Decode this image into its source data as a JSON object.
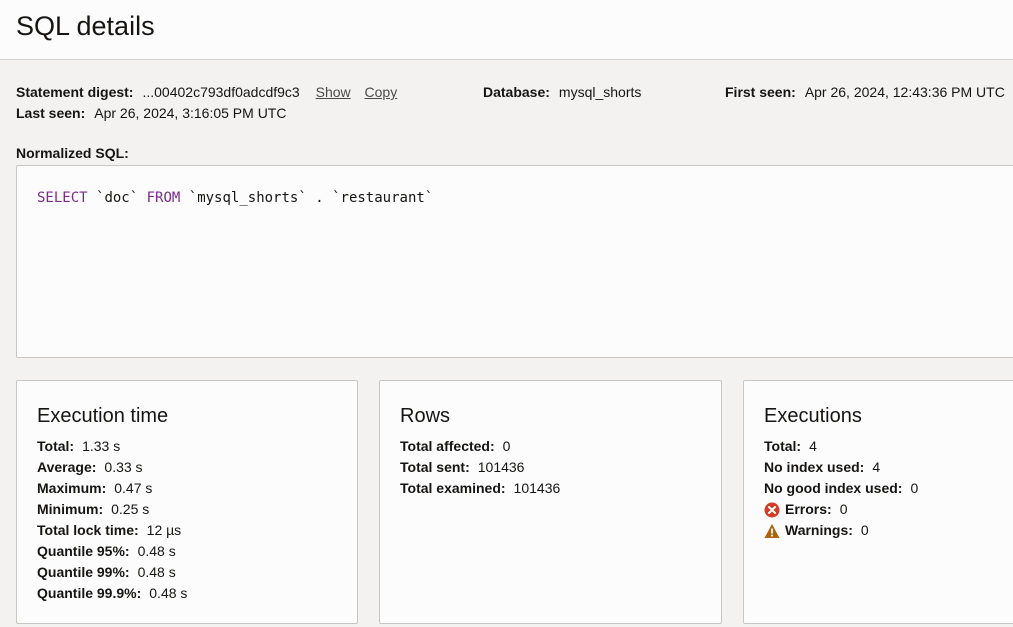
{
  "header": {
    "title": "SQL details"
  },
  "meta": {
    "digest_label": "Statement digest:",
    "digest_value": "...00402c793df0adcdf9c3",
    "show_link": "Show",
    "copy_link": "Copy",
    "database_label": "Database:",
    "database_value": "mysql_shorts",
    "first_seen_label": "First seen:",
    "first_seen_value": "Apr 26, 2024, 12:43:36 PM UTC",
    "last_seen_label": "Last seen:",
    "last_seen_value": "Apr 26, 2024, 3:16:05 PM UTC"
  },
  "sql": {
    "label": "Normalized SQL:",
    "tokens": {
      "select": "SELECT",
      "col": "`doc`",
      "from": "FROM",
      "schema": "`mysql_shorts`",
      "dot": ".",
      "table": "`restaurant`"
    }
  },
  "execution_time": {
    "title": "Execution time",
    "rows": [
      {
        "label": "Total:",
        "value": "1.33 s"
      },
      {
        "label": "Average:",
        "value": "0.33 s"
      },
      {
        "label": "Maximum:",
        "value": "0.47 s"
      },
      {
        "label": "Minimum:",
        "value": "0.25 s"
      },
      {
        "label": "Total lock time:",
        "value": "12 µs"
      },
      {
        "label": "Quantile 95%:",
        "value": "0.48 s"
      },
      {
        "label": "Quantile 99%:",
        "value": "0.48 s"
      },
      {
        "label": "Quantile 99.9%:",
        "value": "0.48 s"
      }
    ]
  },
  "rows_card": {
    "title": "Rows",
    "rows": [
      {
        "label": "Total affected:",
        "value": "0"
      },
      {
        "label": "Total sent:",
        "value": "101436"
      },
      {
        "label": "Total examined:",
        "value": "101436"
      }
    ]
  },
  "executions": {
    "title": "Executions",
    "rows": [
      {
        "label": "Total:",
        "value": "4"
      },
      {
        "label": "No index used:",
        "value": "4"
      },
      {
        "label": "No good index used:",
        "value": "0"
      },
      {
        "label": "Errors:",
        "value": "0",
        "icon": "error-icon"
      },
      {
        "label": "Warnings:",
        "value": "0",
        "icon": "warning-icon"
      }
    ]
  },
  "colors": {
    "keyword": "#7b2a8c",
    "error": "#d63b25",
    "warning": "#ac630c"
  }
}
